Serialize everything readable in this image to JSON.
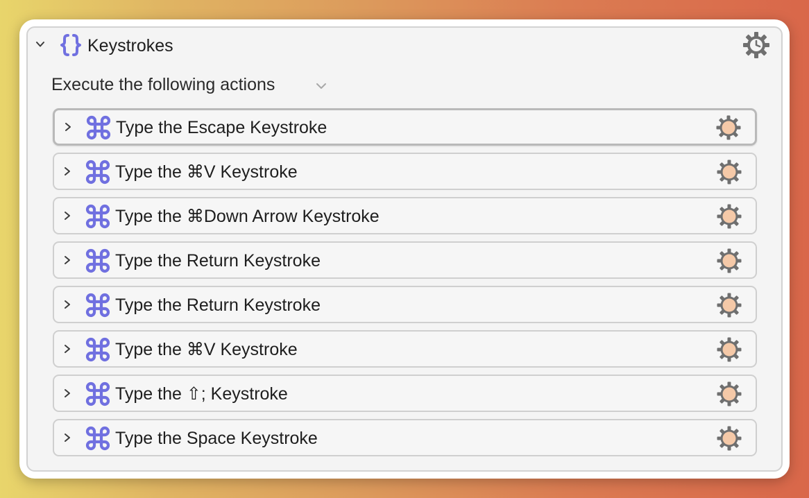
{
  "group": {
    "title": "Keystrokes",
    "icon": "curly-braces-icon",
    "execute_label": "Execute the following actions",
    "accent_color": "#7070e0"
  },
  "actions": [
    {
      "label": "Type the Escape Keystroke",
      "selected": true
    },
    {
      "label": "Type the ⌘V Keystroke",
      "selected": false
    },
    {
      "label": "Type the ⌘Down Arrow Keystroke",
      "selected": false
    },
    {
      "label": "Type the Return Keystroke",
      "selected": false
    },
    {
      "label": "Type the Return Keystroke",
      "selected": false
    },
    {
      "label": "Type the ⌘V Keystroke",
      "selected": false
    },
    {
      "label": "Type the ⇧; Keystroke",
      "selected": false
    },
    {
      "label": "Type the Space Keystroke",
      "selected": false
    }
  ],
  "icons": {
    "action_icon": "command-key-icon",
    "action_gear": "gear-icon",
    "header_gear": "gear-clock-icon",
    "expand": "chevron-right-icon",
    "collapse": "chevron-down-icon"
  },
  "colors": {
    "icon_purple": "#7070e0",
    "gear_gray": "#6f6f6f",
    "gear_fill": "#f5c9a8"
  }
}
